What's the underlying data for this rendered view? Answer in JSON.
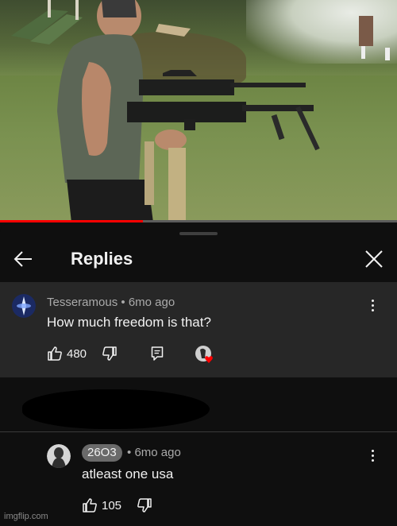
{
  "video": {
    "progress_fraction": 0.36,
    "progress_color": "#ff0000"
  },
  "sheet": {
    "title": "Replies",
    "back_icon": "arrow-left-icon",
    "close_icon": "close-icon"
  },
  "parent_comment": {
    "author": "Tesseramous",
    "time": "6mo ago",
    "text": "How much freedom is that?",
    "likes": "480",
    "icons": [
      "thumbs-up-icon",
      "thumbs-down-icon",
      "reply-icon",
      "creator-heart-icon",
      "more-vert-icon"
    ]
  },
  "reply": {
    "author": "26O3",
    "time": "6mo ago",
    "text": "atleast one usa",
    "likes": "105",
    "icons": [
      "thumbs-up-icon",
      "thumbs-down-icon",
      "more-vert-icon"
    ]
  },
  "separator": "•",
  "watermark": "imgflip.com",
  "colors": {
    "background": "#0f0f0f",
    "highlight": "#272727",
    "secondary_text": "#aaaaaa",
    "heart": "#ff0000"
  }
}
